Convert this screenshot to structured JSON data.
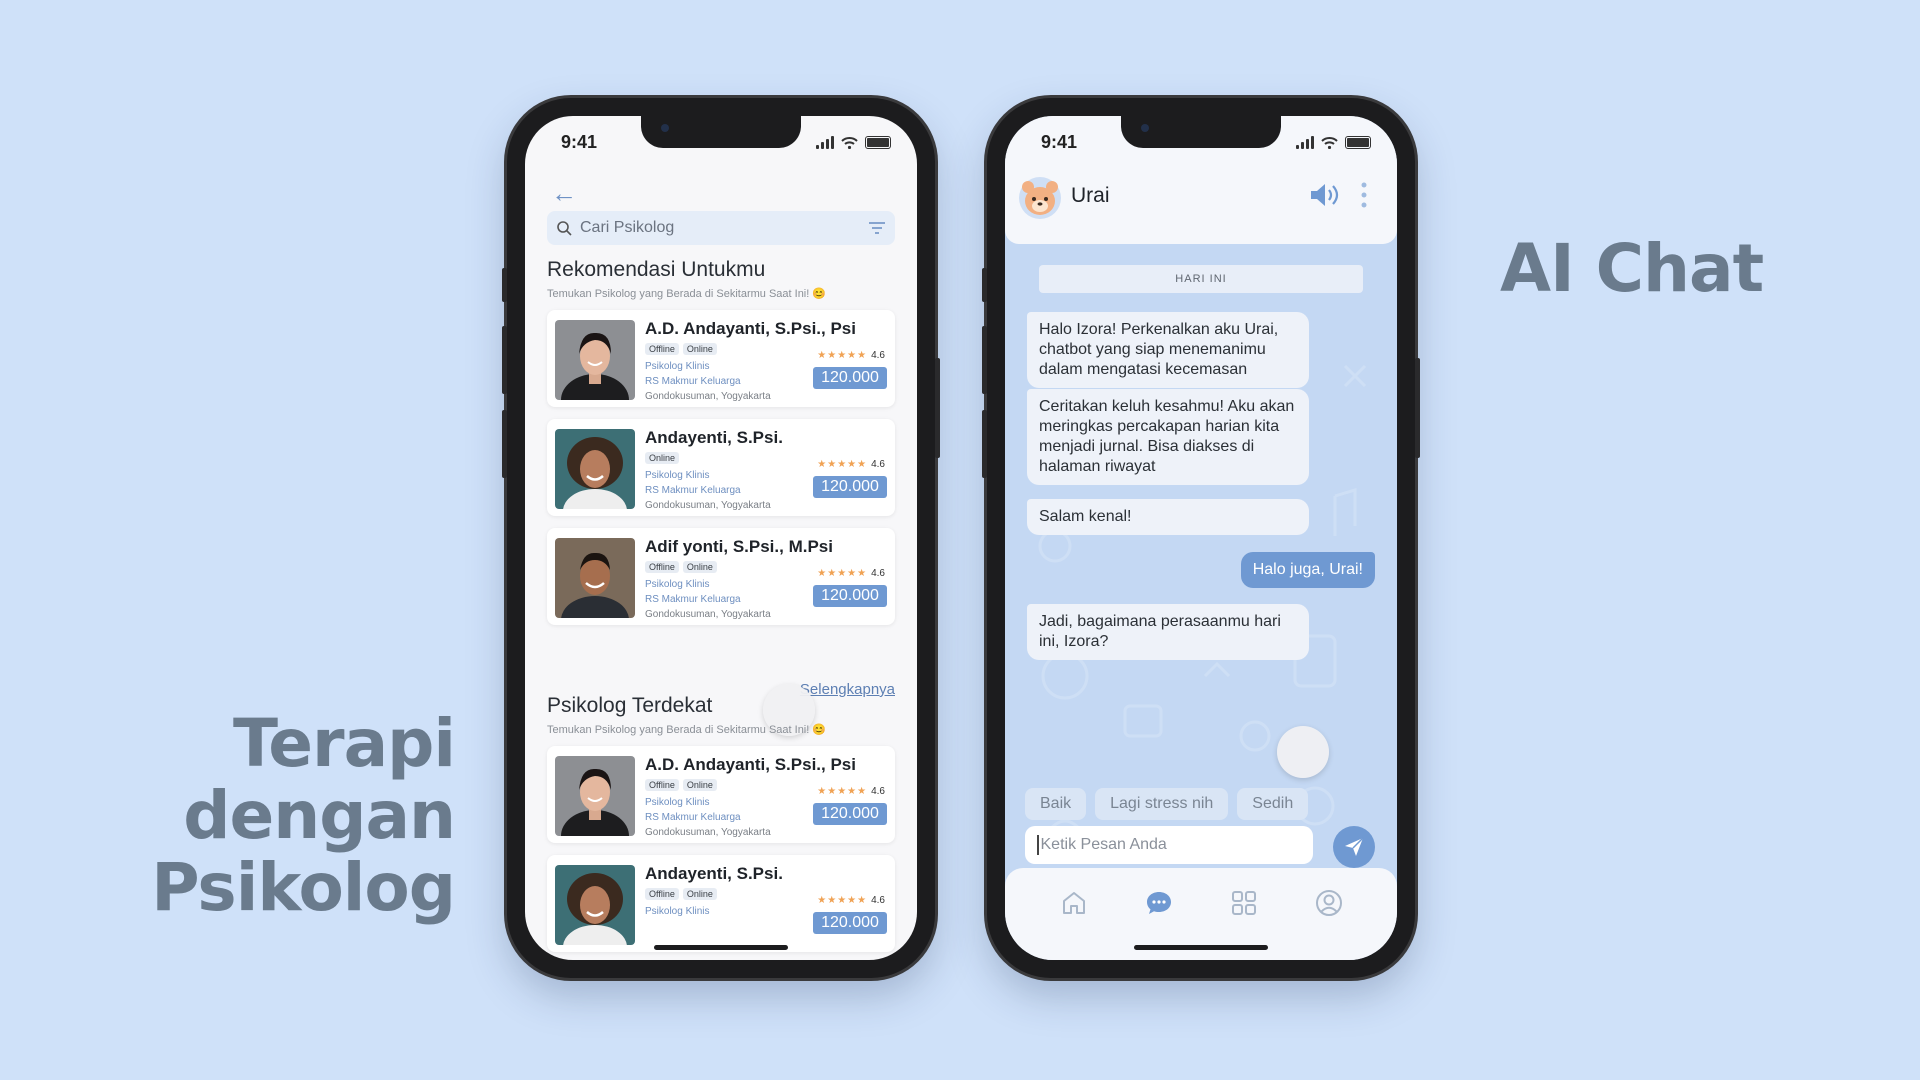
{
  "headings": {
    "ai_chat": "AI Chat",
    "terapi_line1": "Terapi",
    "terapi_line2": "dengan",
    "terapi_line3": "Psikolog"
  },
  "status_bar": {
    "time": "9:41"
  },
  "psikolog_screen": {
    "search_placeholder": "Cari Psikolog",
    "recommend": {
      "title": "Rekomendasi Untukmu",
      "subtitle": "Temukan Psikolog yang Berada di Sekitarmu Saat Ini! 😊"
    },
    "see_more": "Selengkapnya",
    "nearby": {
      "title": "Psikolog Terdekat",
      "subtitle": "Temukan Psikolog yang Berada di Sekitarmu Saat Ini! 😊"
    },
    "recommend_cards": [
      {
        "name": "A.D. Andayanti, S.Psi., Psi",
        "tags": [
          "Offline",
          "Online"
        ],
        "specialty": "Psikolog Klinis",
        "hospital": "RS Makmur Keluarga",
        "location": "Gondokusuman, Yogyakarta",
        "rating": "4.6",
        "price": "120.000"
      },
      {
        "name": "Andayenti, S.Psi.",
        "tags": [
          "Online"
        ],
        "specialty": "Psikolog Klinis",
        "hospital": "RS Makmur Keluarga",
        "location": "Gondokusuman, Yogyakarta",
        "rating": "4.6",
        "price": "120.000"
      },
      {
        "name": "Adif yonti, S.Psi., M.Psi",
        "tags": [
          "Offline",
          "Online"
        ],
        "specialty": "Psikolog Klinis",
        "hospital": "RS Makmur Keluarga",
        "location": "Gondokusuman, Yogyakarta",
        "rating": "4.6",
        "price": "120.000"
      }
    ],
    "nearby_cards": [
      {
        "name": "A.D. Andayanti, S.Psi., Psi",
        "tags": [
          "Offline",
          "Online"
        ],
        "specialty": "Psikolog Klinis",
        "hospital": "RS Makmur Keluarga",
        "location": "Gondokusuman, Yogyakarta",
        "rating": "4.6",
        "price": "120.000"
      },
      {
        "name": "Andayenti, S.Psi.",
        "tags": [
          "Offline",
          "Online"
        ],
        "specialty": "Psikolog Klinis",
        "hospital": "",
        "location": "",
        "rating": "4.6",
        "price": "120.000"
      }
    ]
  },
  "chat_screen": {
    "bot_name": "Urai",
    "date_label": "HARI INI",
    "messages": [
      {
        "from": "bot",
        "text": "Halo Izora! Perkenalkan aku Urai, chatbot yang siap menemanimu dalam mengatasi kecemasan"
      },
      {
        "from": "bot",
        "text": "Ceritakan keluh kesahmu! Aku akan meringkas percakapan harian kita menjadi jurnal. Bisa diakses di halaman riwayat"
      },
      {
        "from": "bot",
        "text": "Salam kenal!"
      },
      {
        "from": "user",
        "text": "Halo juga, Urai!"
      },
      {
        "from": "bot",
        "text": "Jadi, bagaimana perasaanmu hari ini, Izora?"
      }
    ],
    "quick_replies": [
      "Baik",
      "Lagi stress nih",
      "Sedih"
    ],
    "input_placeholder": "Ketik Pesan Anda",
    "tabs": [
      "home-icon",
      "chat-icon",
      "grid-icon",
      "profile-icon"
    ],
    "accent": "#6f99d2"
  }
}
